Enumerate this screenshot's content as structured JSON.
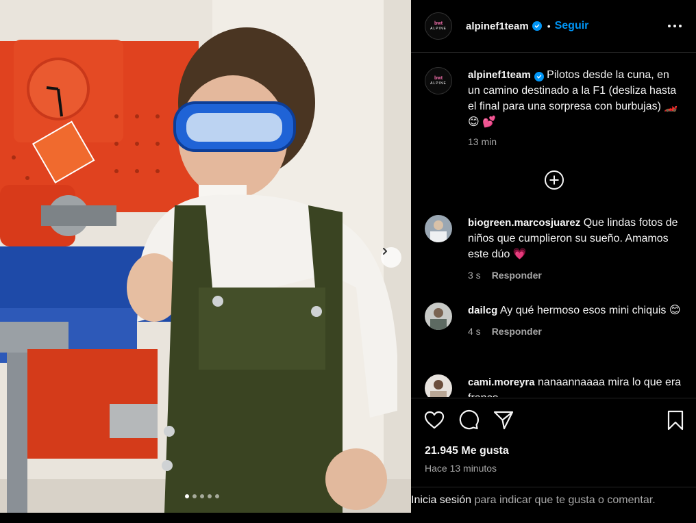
{
  "post": {
    "username": "alpinef1team",
    "follow_label": "Seguir",
    "avatar_text_top": "bwt",
    "avatar_text_bottom": "ALPINE",
    "caption": "Pilotos desde la cuna, en un camino destinado a la F1 (desliza hasta el final para una sorpresa con burbujas) 🏎️ 😊 💕",
    "caption_time": "13 min",
    "likes": "21.945 Me gusta",
    "posted": "Hace 13 minutos",
    "carousel": {
      "total": 5,
      "active": 0
    }
  },
  "comments": [
    {
      "user": "biogreen.marcosjuarez",
      "text": "Que lindas fotos de niños que cumplieron su sueño. Amamos este dúo 💗",
      "time": "3 s",
      "reply": "Responder"
    },
    {
      "user": "dailcg",
      "text": "Ay qué hermoso esos mini chiquis 😊",
      "time": "4 s",
      "reply": "Responder"
    },
    {
      "user": "cami.moreyra",
      "text": "nanaannaaaa mira lo que era franco"
    }
  ],
  "login": {
    "link": "Inicia sesión",
    "rest": " para indicar que te gusta o comentar."
  },
  "icons": {
    "more": "more-options-icon",
    "verified": "verified-badge-icon",
    "load_more": "load-more-comments-icon",
    "like": "heart-icon",
    "comment": "comment-icon",
    "share": "share-icon",
    "save": "bookmark-icon",
    "next": "chevron-right-icon"
  },
  "colors": {
    "accent": "#0095f6",
    "background": "#000000",
    "text": "#f5f5f5",
    "muted": "#a8a8a8"
  }
}
